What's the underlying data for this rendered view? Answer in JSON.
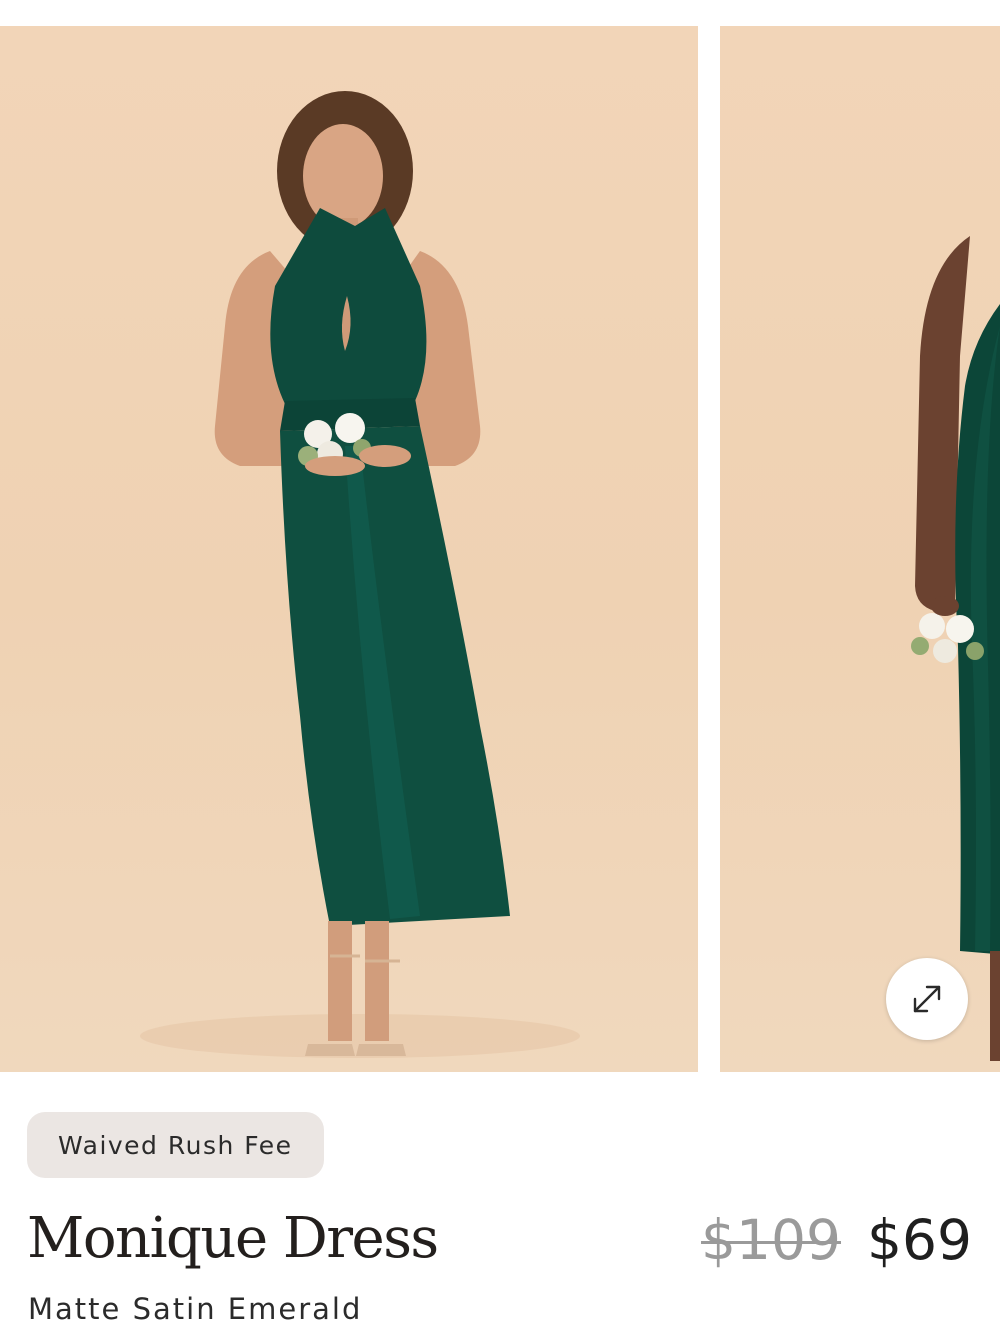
{
  "gallery": {
    "images": [
      {
        "name": "product-photo-front",
        "alt": "Model wearing emerald halter midi dress holding bouquet"
      },
      {
        "name": "product-photo-side",
        "alt": "Model wearing emerald dress side view"
      }
    ],
    "expand_icon": "expand-arrows-icon"
  },
  "product": {
    "badge": "Waived Rush Fee",
    "name": "Monique Dress",
    "original_price": "$109",
    "sale_price": "$69",
    "variant": "Matte Satin Emerald"
  },
  "colors": {
    "backdrop": "#f0d4b6",
    "dress": "#0e4b3d",
    "badge_bg": "#ebe6e3",
    "text": "#231f1d",
    "strike_price": "#9a9a9a"
  }
}
